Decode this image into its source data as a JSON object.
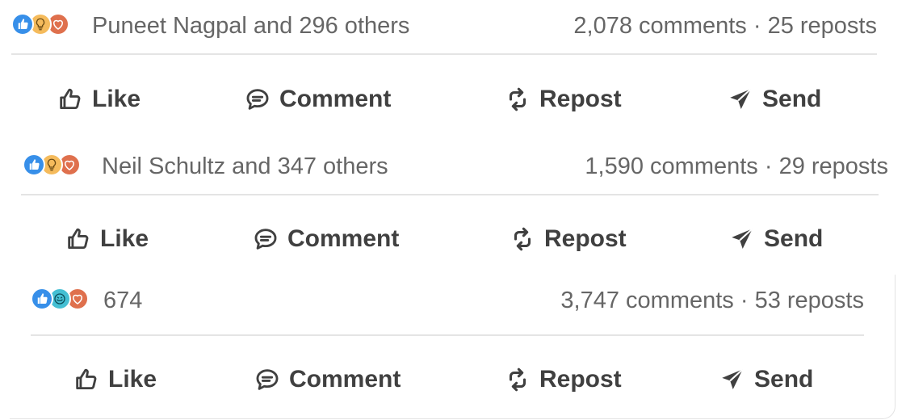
{
  "posts": [
    {
      "reactions": [
        "like-icon",
        "insightful-icon",
        "love-icon"
      ],
      "reactor_text": "Puneet Nagpal and 296 others",
      "stats_text": "2,078 comments · 25 reposts",
      "actions": {
        "like": "Like",
        "comment": "Comment",
        "repost": "Repost",
        "send": "Send"
      }
    },
    {
      "reactions": [
        "like-icon",
        "insightful-icon",
        "love-icon"
      ],
      "reactor_text": "Neil Schultz and 347 others",
      "stats_text": "1,590 comments · 29 reposts",
      "actions": {
        "like": "Like",
        "comment": "Comment",
        "repost": "Repost",
        "send": "Send"
      }
    },
    {
      "reactions": [
        "like-icon",
        "funny-icon",
        "love-icon"
      ],
      "reactor_text": "674",
      "stats_text": "3,747 comments · 53 reposts",
      "actions": {
        "like": "Like",
        "comment": "Comment",
        "repost": "Repost",
        "send": "Send"
      }
    }
  ],
  "colors": {
    "like_blue": "#378fe9",
    "insightful_yellow": "#f5bb5c",
    "love_red": "#df704d",
    "funny_teal": "#44bfd3",
    "meta_text": "#666666",
    "action_text": "#404040"
  }
}
